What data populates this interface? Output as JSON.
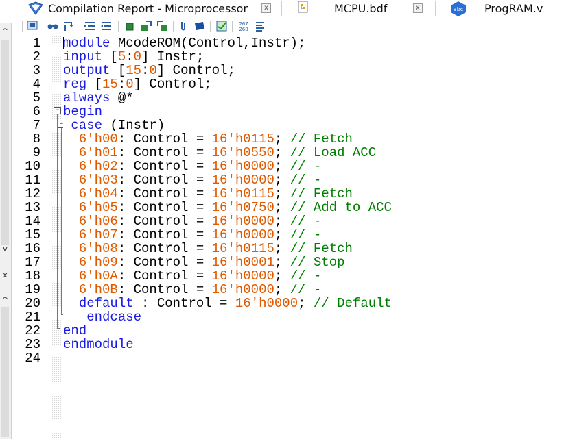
{
  "tabs": [
    {
      "label": "Compilation Report - Microprocessor",
      "icon": "compilation-report-icon",
      "close": "x",
      "active": true
    },
    {
      "label": "MCPU.bdf",
      "icon": "bdf-file-icon",
      "close": "x",
      "active": false
    },
    {
      "label": "ProgRAM.v",
      "icon": "verilog-file-icon",
      "icon_text": "abc",
      "active": false
    }
  ],
  "toolbar": {
    "icons": [
      "editor-settings-icon",
      "find-icon",
      "find-next-icon",
      "indent-icon",
      "unindent-icon",
      "bookmark-toggle-icon",
      "bookmark-next-icon",
      "bookmark-prev-icon",
      "attach-icon",
      "comment-icon",
      "insert-template-icon",
      "line-number-icon",
      "format-icon"
    ],
    "line_number_icon_text": [
      "267",
      "268"
    ]
  },
  "left_strip": {
    "up_arrow": "^",
    "down_arrow": "v",
    "close": "x"
  },
  "colors": {
    "keyword": "#1a1ae6",
    "number": "#e05a00",
    "comment": "#008000",
    "text": "#000000"
  },
  "editor": {
    "line_numbers": [
      "1",
      "2",
      "3",
      "4",
      "5",
      "6",
      "7",
      "8",
      "9",
      "10",
      "11",
      "12",
      "13",
      "14",
      "15",
      "16",
      "17",
      "18",
      "19",
      "20",
      "21",
      "22",
      "23",
      "24"
    ],
    "lines": [
      [
        [
          "kw",
          "module"
        ],
        [
          "t",
          " McodeROM(Control,Instr);"
        ]
      ],
      [
        [
          "kw",
          "input"
        ],
        [
          "t",
          " ["
        ],
        [
          "num",
          "5"
        ],
        [
          "t",
          ":"
        ],
        [
          "num",
          "0"
        ],
        [
          "t",
          "] Instr;"
        ]
      ],
      [
        [
          "kw",
          "output"
        ],
        [
          "t",
          " ["
        ],
        [
          "num",
          "15"
        ],
        [
          "t",
          ":"
        ],
        [
          "num",
          "0"
        ],
        [
          "t",
          "] Control;"
        ]
      ],
      [
        [
          "kw",
          "reg"
        ],
        [
          "t",
          " ["
        ],
        [
          "num",
          "15"
        ],
        [
          "t",
          ":"
        ],
        [
          "num",
          "0"
        ],
        [
          "t",
          "] Control;"
        ]
      ],
      [
        [
          "kw",
          "always"
        ],
        [
          "t",
          " @*"
        ]
      ],
      [
        [
          "kw",
          "begin"
        ]
      ],
      [
        [
          "t",
          " "
        ],
        [
          "kw",
          "case"
        ],
        [
          "t",
          " (Instr)"
        ]
      ],
      [
        [
          "t",
          "  "
        ],
        [
          "num",
          "6'h00"
        ],
        [
          "t",
          ": Control = "
        ],
        [
          "num",
          "16'h0115"
        ],
        [
          "t",
          "; "
        ],
        [
          "cm",
          "// Fetch"
        ]
      ],
      [
        [
          "t",
          "  "
        ],
        [
          "num",
          "6'h01"
        ],
        [
          "t",
          ": Control = "
        ],
        [
          "num",
          "16'h0550"
        ],
        [
          "t",
          "; "
        ],
        [
          "cm",
          "// Load ACC"
        ]
      ],
      [
        [
          "t",
          "  "
        ],
        [
          "num",
          "6'h02"
        ],
        [
          "t",
          ": Control = "
        ],
        [
          "num",
          "16'h0000"
        ],
        [
          "t",
          "; "
        ],
        [
          "cm",
          "// -"
        ]
      ],
      [
        [
          "t",
          "  "
        ],
        [
          "num",
          "6'h03"
        ],
        [
          "t",
          ": Control = "
        ],
        [
          "num",
          "16'h0000"
        ],
        [
          "t",
          "; "
        ],
        [
          "cm",
          "// -"
        ]
      ],
      [
        [
          "t",
          "  "
        ],
        [
          "num",
          "6'h04"
        ],
        [
          "t",
          ": Control = "
        ],
        [
          "num",
          "16'h0115"
        ],
        [
          "t",
          "; "
        ],
        [
          "cm",
          "// Fetch"
        ]
      ],
      [
        [
          "t",
          "  "
        ],
        [
          "num",
          "6'h05"
        ],
        [
          "t",
          ": Control = "
        ],
        [
          "num",
          "16'h0750"
        ],
        [
          "t",
          "; "
        ],
        [
          "cm",
          "// Add to ACC"
        ]
      ],
      [
        [
          "t",
          "  "
        ],
        [
          "num",
          "6'h06"
        ],
        [
          "t",
          ": Control = "
        ],
        [
          "num",
          "16'h0000"
        ],
        [
          "t",
          "; "
        ],
        [
          "cm",
          "// -"
        ]
      ],
      [
        [
          "t",
          "  "
        ],
        [
          "num",
          "6'h07"
        ],
        [
          "t",
          ": Control = "
        ],
        [
          "num",
          "16'h0000"
        ],
        [
          "t",
          "; "
        ],
        [
          "cm",
          "// -"
        ]
      ],
      [
        [
          "t",
          "  "
        ],
        [
          "num",
          "6'h08"
        ],
        [
          "t",
          ": Control = "
        ],
        [
          "num",
          "16'h0115"
        ],
        [
          "t",
          "; "
        ],
        [
          "cm",
          "// Fetch"
        ]
      ],
      [
        [
          "t",
          "  "
        ],
        [
          "num",
          "6'h09"
        ],
        [
          "t",
          ": Control = "
        ],
        [
          "num",
          "16'h0001"
        ],
        [
          "t",
          "; "
        ],
        [
          "cm",
          "// Stop"
        ]
      ],
      [
        [
          "t",
          "  "
        ],
        [
          "num",
          "6'h0A"
        ],
        [
          "t",
          ": Control = "
        ],
        [
          "num",
          "16'h0000"
        ],
        [
          "t",
          "; "
        ],
        [
          "cm",
          "// -"
        ]
      ],
      [
        [
          "t",
          "  "
        ],
        [
          "num",
          "6'h0B"
        ],
        [
          "t",
          ": Control = "
        ],
        [
          "num",
          "16'h0000"
        ],
        [
          "t",
          "; "
        ],
        [
          "cm",
          "// -"
        ]
      ],
      [
        [
          "t",
          "  "
        ],
        [
          "kw",
          "default"
        ],
        [
          "t",
          " : Control = "
        ],
        [
          "num",
          "16'h0000"
        ],
        [
          "t",
          "; "
        ],
        [
          "cm",
          "// Default"
        ]
      ],
      [
        [
          "t",
          "   "
        ],
        [
          "kw",
          "endcase"
        ]
      ],
      [
        [
          "kw",
          "end"
        ]
      ],
      [
        [
          "kw",
          "endmodule"
        ]
      ],
      []
    ]
  }
}
